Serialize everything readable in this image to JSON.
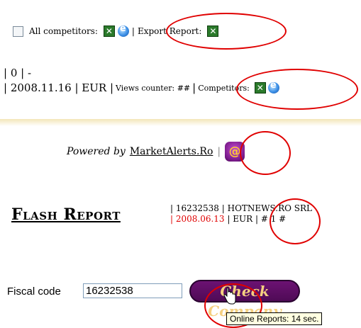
{
  "row1": {
    "all_competitors_label": "All competitors:",
    "export_report_label": "Export Report:",
    "sep": "|"
  },
  "row2": {
    "line1": "| 0 | -",
    "line2_prefix": "| 2008.11.16 | EUR |",
    "views_counter": "Views counter: ##",
    "sep": "|",
    "competitors_label": "Competitors:"
  },
  "powered": {
    "powered_by": "Powered by",
    "site": "MarketAlerts.Ro",
    "sep": "|",
    "at_symbol": "@"
  },
  "flash": {
    "title": "Flash Report",
    "line1": "| 16232538 | HOTNEWS.RO SRL",
    "date": "| 2008.06.13",
    "rest": "| EUR | # 1 #"
  },
  "fiscal": {
    "label": "Fiscal code",
    "value": "16232538",
    "button": "Check Company",
    "tooltip": "Online Reports: 14 sec."
  },
  "colors": {
    "annotation": "#e00000",
    "button_bg": "#5a0c62",
    "date_red": "#e00000"
  }
}
